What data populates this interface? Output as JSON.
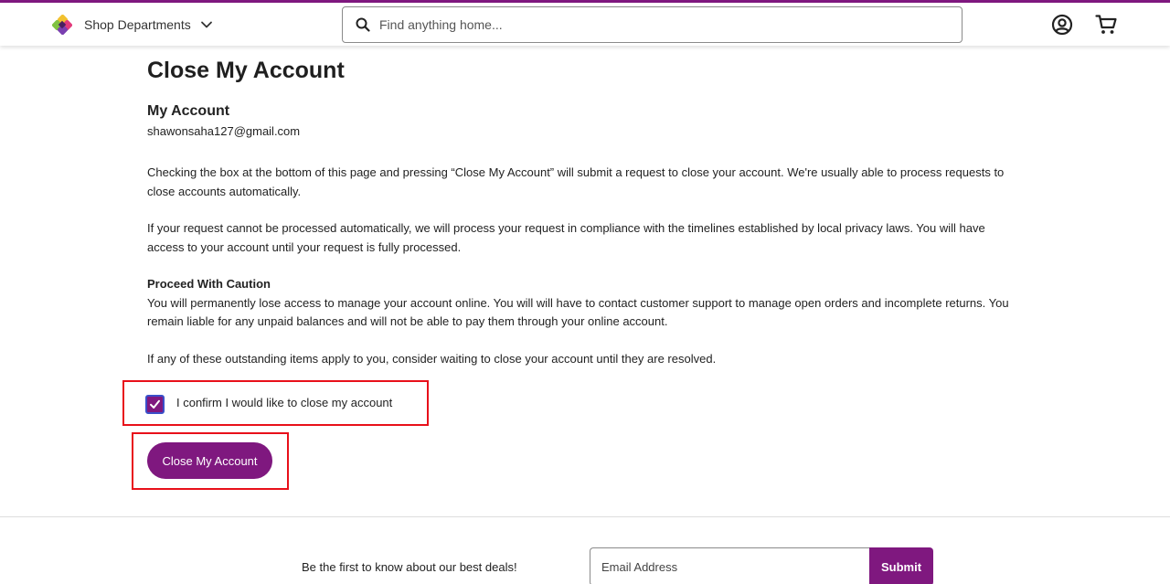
{
  "header": {
    "departments_label": "Shop Departments",
    "search_placeholder": "Find anything home..."
  },
  "page": {
    "title": "Close My Account",
    "account_heading": "My Account",
    "account_email": "shawonsaha127@gmail.com",
    "paragraph1": "Checking the box at the bottom of this page and pressing “Close My Account” will submit a request to close your account. We're usually able to process requests to close accounts automatically.",
    "paragraph2": "If your request cannot be processed automatically, we will process your request in compliance with the timelines established by local privacy laws. You will have access to your account until your request is fully processed.",
    "caution_title": "Proceed With Caution",
    "caution_text": "You will permanently lose access to manage your account online. You will will have to contact customer support to manage open orders and incomplete returns. You remain liable for any unpaid balances and will not be able to pay them through your online account.",
    "paragraph4": "If any of these outstanding items apply to you, consider waiting to close your account until they are resolved.",
    "confirm_label": "I confirm I would like to close my account",
    "confirm_checked": true,
    "close_button_label": "Close My Account"
  },
  "footer": {
    "newsletter_text": "Be the first to know about our best deals!",
    "email_placeholder": "Email Address",
    "submit_label": "Submit"
  },
  "colors": {
    "brand": "#7f187f",
    "highlight_box": "#e8101a"
  }
}
